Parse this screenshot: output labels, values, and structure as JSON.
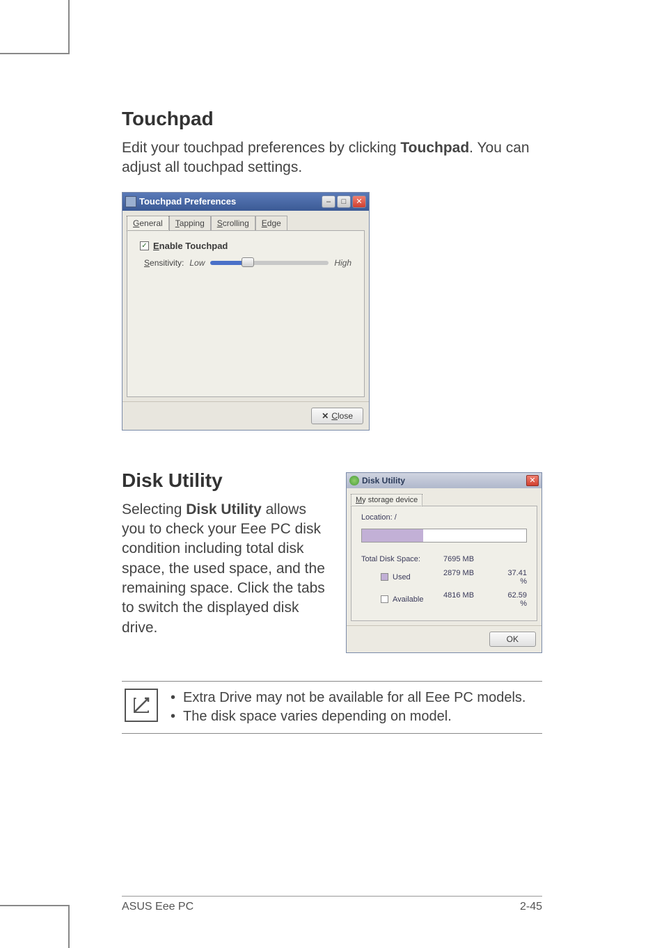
{
  "sections": {
    "touchpad": {
      "heading": "Touchpad",
      "para_pre": "Edit your touchpad preferences by clicking ",
      "para_bold": "Touchpad",
      "para_post": ". You can adjust all touchpad settings."
    },
    "disk": {
      "heading": "Disk Utility",
      "para_pre": "Selecting ",
      "para_bold": "Disk Utility",
      "para_post": " allows you to check your Eee PC disk condition including total disk space, the used space, and the remaining space. Click the tabs to switch the displayed disk drive."
    }
  },
  "touchpad_window": {
    "title": "Touchpad Preferences",
    "tabs": [
      "General",
      "Tapping",
      "Scrolling",
      "Edge"
    ],
    "active_tab": 0,
    "enable_label": "Enable Touchpad",
    "enable_checked": true,
    "sensitivity_label": "Sensitivity:",
    "low": "Low",
    "high": "High",
    "close_btn": "Close"
  },
  "disk_window": {
    "title": "Disk Utility",
    "tab": "My storage device",
    "location_label": "Location: /",
    "rows": {
      "total": {
        "label": "Total Disk Space:",
        "size": "7695 MB",
        "pct": ""
      },
      "used": {
        "label": "Used",
        "size": "2879 MB",
        "pct": "37.41 %"
      },
      "avail": {
        "label": "Available",
        "size": "4816 MB",
        "pct": "62.59 %"
      }
    },
    "ok_btn": "OK"
  },
  "notes": [
    "Extra Drive may not be available for all Eee PC models.",
    "The disk space varies depending on model."
  ],
  "footer": {
    "left": "ASUS Eee PC",
    "right": "2-45"
  }
}
